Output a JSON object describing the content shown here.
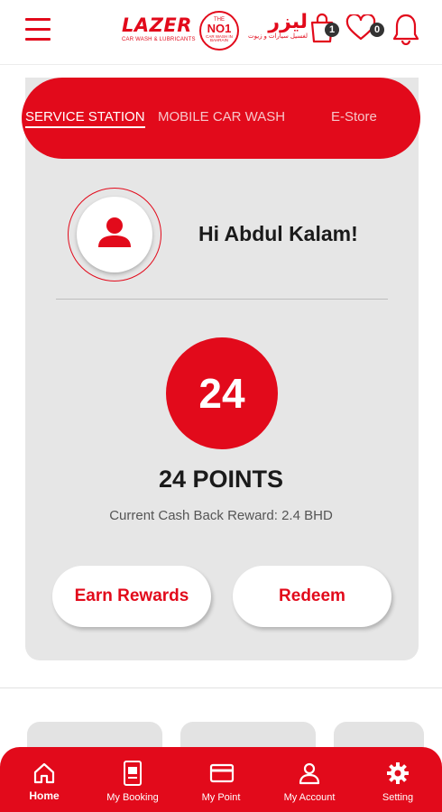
{
  "header": {
    "logo_en": "LAZER",
    "logo_en_sub": "CAR WASH & LUBRICANTS",
    "seal_top": "THE",
    "seal_main": "NO1",
    "seal_bottom": "CAR WASH IN BAHRAIN",
    "logo_ar": "ليزر",
    "logo_ar_sub": "لغسيل سيارات و زيوت",
    "cart_count": "1",
    "wishlist_count": "0"
  },
  "tabs": [
    {
      "label": "SERVICE  STATION",
      "active": true
    },
    {
      "label": "MOBILE CAR WASH",
      "active": false
    },
    {
      "label": "E-Store",
      "active": false
    }
  ],
  "profile": {
    "greeting": "Hi Abdul Kalam!"
  },
  "points": {
    "value": "24",
    "label": "24 POINTS",
    "cashback": "Current Cash Back Reward: 2.4 BHD"
  },
  "actions": {
    "earn": "Earn Rewards",
    "redeem": "Redeem"
  },
  "bottom_nav": [
    {
      "label": "Home",
      "icon": "home-icon",
      "active": true
    },
    {
      "label": "My Booking",
      "icon": "booking-icon",
      "active": false
    },
    {
      "label": "My Point",
      "icon": "card-icon",
      "active": false
    },
    {
      "label": "My Account",
      "icon": "user-icon",
      "active": false
    },
    {
      "label": "Setting",
      "icon": "gear-icon",
      "active": false
    }
  ],
  "colors": {
    "brand": "#e20a1b",
    "card_bg": "#e6e6e6"
  }
}
